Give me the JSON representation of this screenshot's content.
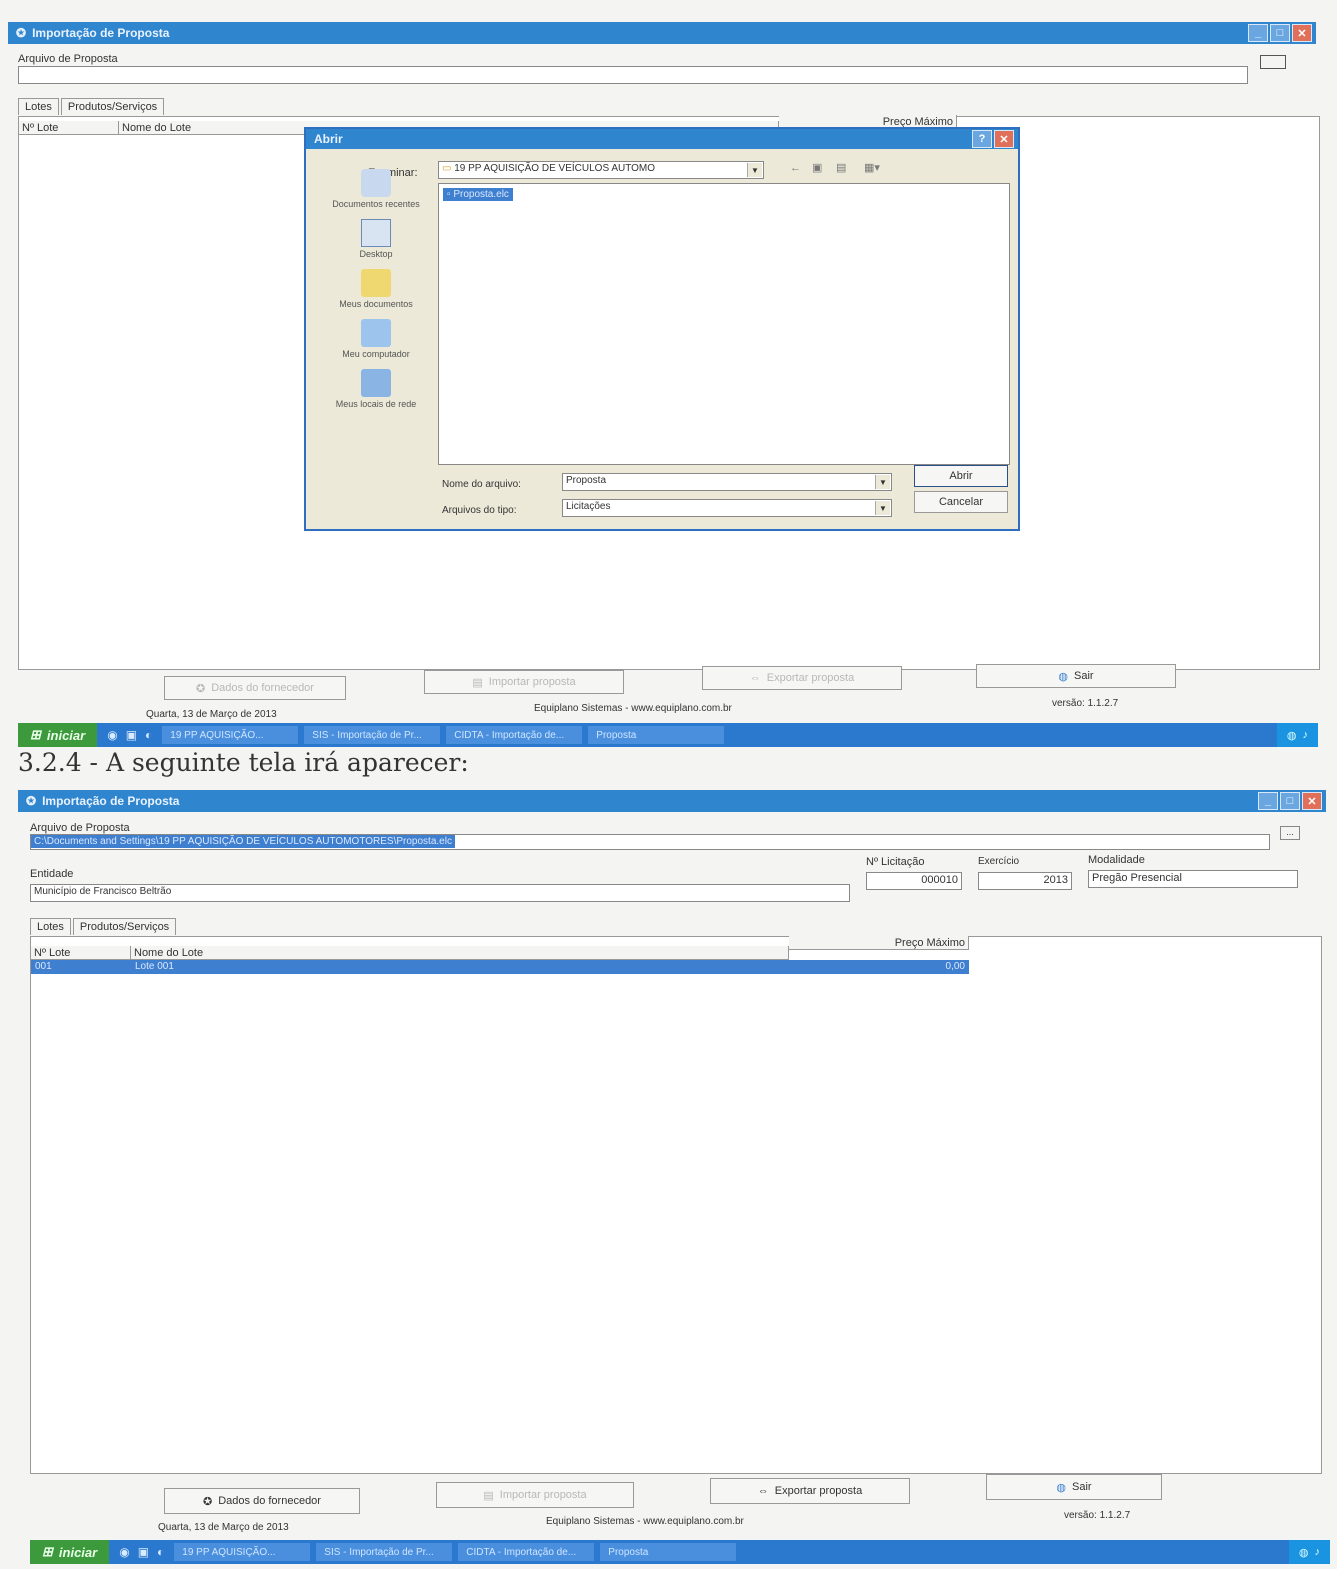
{
  "top": {
    "title": "Importação de Proposta",
    "file_label": "Arquivo de Proposta",
    "tabs": [
      "Lotes",
      "Produtos/Serviços"
    ],
    "columns": [
      "Nº Lote",
      "Nome do Lote",
      "Preço Máximo"
    ],
    "buttons": {
      "dados": "Dados do fornecedor",
      "importar": "Importar proposta",
      "exportar": "Exportar proposta",
      "sair": "Sair"
    },
    "status_date": "Quarta, 13 de Março de 2013",
    "status_company": "Equiplano Sistemas - www.equiplano.com.br",
    "status_version": "versão: 1.1.2.7"
  },
  "dialog": {
    "title": "Abrir",
    "examinar_label": "Examinar:",
    "folder": "19 PP AQUISIÇÃO DE VEÍCULOS AUTOMO",
    "selected_file": "Proposta.elc",
    "places": [
      "Documentos recentes",
      "Desktop",
      "Meus documentos",
      "Meu computador",
      "Meus locais de rede"
    ],
    "filename_label": "Nome do arquivo:",
    "filename_value": "Proposta",
    "filetype_label": "Arquivos do tipo:",
    "filetype_value": "Licitações",
    "open_button": "Abrir",
    "cancel_button": "Cancelar"
  },
  "taskbar_top": {
    "start": "iniciar",
    "tasks": [
      "19 PP AQUISIÇÃO...",
      "SIS - Importação de Pr...",
      "CIDTA - Importação de...",
      "Proposta"
    ]
  },
  "heading": "3.2.4 - A seguinte tela irá aparecer:",
  "bottom": {
    "title": "Importação de Proposta",
    "file_label": "Arquivo de Proposta",
    "file_value": "C:\\Documents and Settings\\19 PP AQUISIÇÃO DE VEÍCULOS AUTOMOTORES\\Proposta.elc",
    "entidade_label": "Entidade",
    "entidade_value": "Município de Francisco Beltrão",
    "licitacao_label": "Nº Licitação",
    "licitacao_value": "000010",
    "exercicio_label": "Exercício",
    "exercicio_value": "2013",
    "modalidade_label": "Modalidade",
    "modalidade_value": "Pregão Presencial",
    "tabs": [
      "Lotes",
      "Produtos/Serviços"
    ],
    "columns": [
      "Nº Lote",
      "Nome do Lote",
      "Preço Máximo"
    ],
    "row": {
      "lote": "001",
      "nome": "Lote 001",
      "preco": "0,00"
    },
    "buttons": {
      "dados": "Dados do fornecedor",
      "importar": "Importar proposta",
      "exportar": "Exportar proposta",
      "sair": "Sair"
    },
    "status_date": "Quarta, 13 de Março de 2013",
    "status_company": "Equiplano Sistemas - www.equiplano.com.br",
    "status_version": "versão: 1.1.2.7"
  },
  "taskbar_bottom": {
    "start": "iniciar",
    "tasks": [
      "19 PP AQUISIÇÃO...",
      "SIS - Importação de Pr...",
      "CIDTA - Importação de...",
      "Proposta"
    ]
  }
}
